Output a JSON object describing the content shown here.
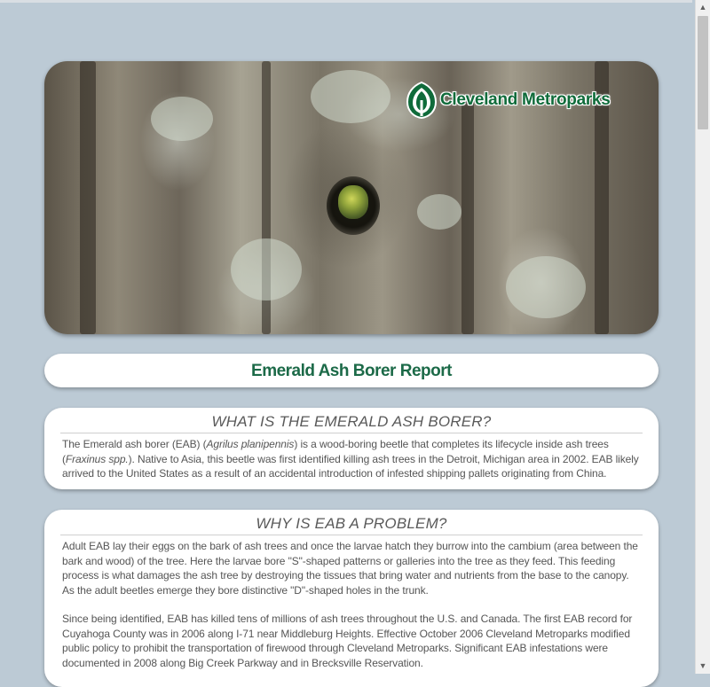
{
  "hero": {
    "logo_text": "Cleveland Metroparks",
    "logo_icon": "leaf-tree-icon"
  },
  "report": {
    "title": "Emerald Ash Borer Report"
  },
  "sections": [
    {
      "heading": "WHAT IS THE EMERALD ASH BORER?",
      "p1_a": "The Emerald ash borer (EAB) (",
      "p1_b": "Agrilus planipennis",
      "p1_c": ") is a wood-boring beetle that completes its lifecycle inside ash trees (",
      "p1_d": "Fraxinus spp.",
      "p1_e": "). Native to Asia, this beetle was first identified killing ash trees in the Detroit, Michigan area in 2002. EAB likely arrived to the United States as a result of an accidental introduction of infested shipping pallets originating from China."
    },
    {
      "heading": "WHY IS EAB A PROBLEM?",
      "p1": "Adult EAB lay their eggs on the bark of ash trees and once the larvae hatch they burrow into the cambium (area between the bark and wood) of the tree. Here the larvae bore \"S\"-shaped patterns or galleries into the tree as they feed. This feeding process is what damages the ash tree by destroying the tissues that bring water and nutrients from the base to the canopy. As the adult beetles emerge they bore distinctive \"D\"-shaped holes in the trunk.",
      "p2": "Since being identified, EAB has killed tens of millions of ash trees throughout the U.S. and Canada. The first EAB record for Cuyahoga County was in 2006 along I-71 near Middleburg Heights. Effective October 2006 Cleveland Metroparks modified public policy to prohibit the transportation of firewood through Cleveland Metroparks. Significant EAB infestations were documented in 2008 along Big Creek Parkway and in Brecksville Reservation."
    }
  ],
  "scrollbar": {
    "up_icon": "triangle-up-icon",
    "down_icon": "triangle-down-icon"
  },
  "colors": {
    "background": "#bccad5",
    "title_green": "#1c6a48",
    "logo_green": "#0f6b3a"
  }
}
